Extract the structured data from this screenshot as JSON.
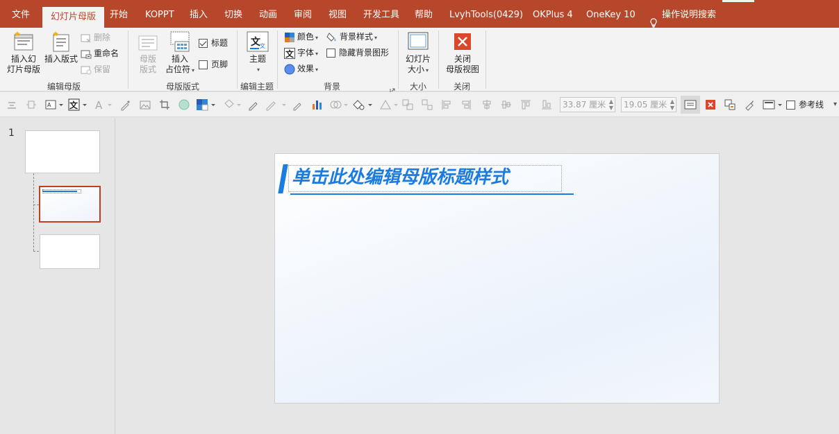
{
  "tabs": [
    {
      "label": "文件"
    },
    {
      "label": "幻灯片母版",
      "active": true
    },
    {
      "label": "开始"
    },
    {
      "label": "KOPPT"
    },
    {
      "label": "插入"
    },
    {
      "label": "切换"
    },
    {
      "label": "动画"
    },
    {
      "label": "审阅"
    },
    {
      "label": "视图"
    },
    {
      "label": "开发工具"
    },
    {
      "label": "帮助"
    },
    {
      "label": "LvyhTools(0429)"
    },
    {
      "label": "OKPlus 4"
    },
    {
      "label": "OneKey 10"
    }
  ],
  "search": {
    "label": "操作说明搜索",
    "icon": "lightbulb-icon"
  },
  "ribbon": {
    "edit_master": {
      "insert_master_l1": "插入幻",
      "insert_master_l2": "灯片母版",
      "insert_layout": "插入版式",
      "delete": "删除",
      "rename": "重命名",
      "preserve": "保留",
      "group": "编辑母版"
    },
    "master_layout": {
      "master_layout_l1": "母版",
      "master_layout_l2": "版式",
      "insert_ph_l1": "插入",
      "insert_ph_l2": "占位符",
      "title": "标题",
      "title_checked": true,
      "footer": "页脚",
      "footer_checked": false,
      "group": "母版版式"
    },
    "edit_theme": {
      "theme": "主题",
      "group": "编辑主题"
    },
    "background": {
      "colors": "颜色",
      "fonts": "字体",
      "effects": "效果",
      "bg_styles": "背景样式",
      "hide_bg": "隐藏背景图形",
      "group": "背景"
    },
    "size": {
      "slide_size_l1": "幻灯片",
      "slide_size_l2": "大小",
      "group": "大小"
    },
    "close": {
      "close_l1": "关闭",
      "close_l2": "母版视图",
      "group": "关闭"
    }
  },
  "toolbar": {
    "width_value": "33.87 厘米",
    "height_value": "19.05 厘米",
    "guides_label": "参考线"
  },
  "thumbnails": {
    "slide_number": "1"
  },
  "slide": {
    "title": "单击此处编辑母版标题样式"
  },
  "colors": {
    "accent": "#b7472a",
    "title_blue": "#1a7be0"
  }
}
